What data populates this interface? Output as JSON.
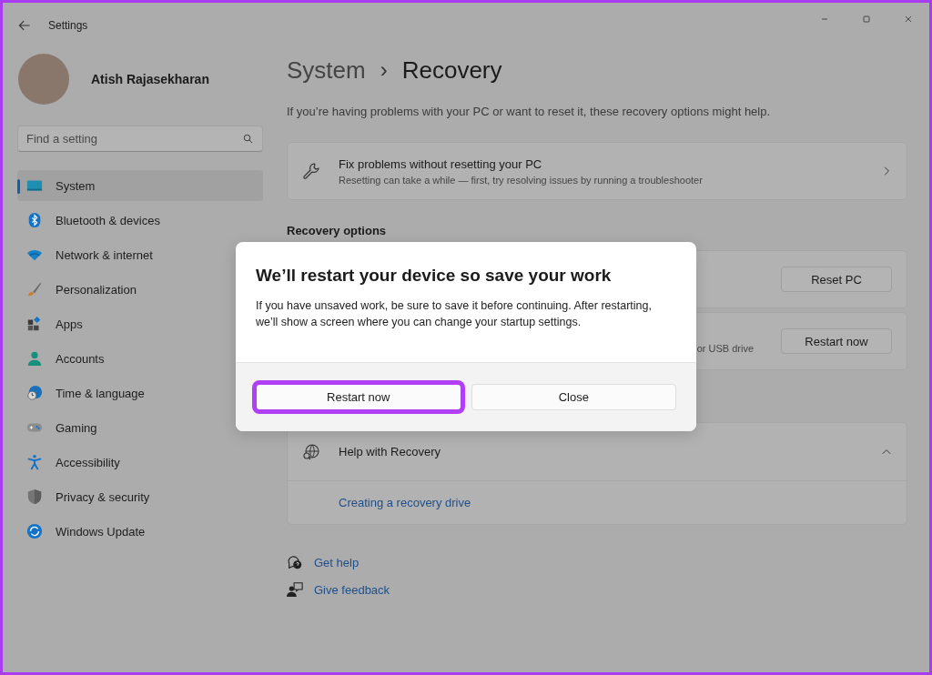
{
  "window": {
    "title": "Settings"
  },
  "profile": {
    "name": "Atish Rajasekharan"
  },
  "search": {
    "placeholder": "Find a setting"
  },
  "sidebar": {
    "items": [
      {
        "label": "System",
        "selected": true
      },
      {
        "label": "Bluetooth & devices",
        "selected": false
      },
      {
        "label": "Network & internet",
        "selected": false
      },
      {
        "label": "Personalization",
        "selected": false
      },
      {
        "label": "Apps",
        "selected": false
      },
      {
        "label": "Accounts",
        "selected": false
      },
      {
        "label": "Time & language",
        "selected": false
      },
      {
        "label": "Gaming",
        "selected": false
      },
      {
        "label": "Accessibility",
        "selected": false
      },
      {
        "label": "Privacy & security",
        "selected": false
      },
      {
        "label": "Windows Update",
        "selected": false
      }
    ]
  },
  "breadcrumb": {
    "parent": "System",
    "separator": "›",
    "current": "Recovery"
  },
  "intro": "If you’re having problems with your PC or want to reset it, these recovery options might help.",
  "fix_card": {
    "title": "Fix problems without resetting your PC",
    "subtitle": "Resetting can take a while — first, try resolving issues by running a troubleshooter"
  },
  "recovery_options": {
    "heading": "Recovery options",
    "rows": [
      {
        "description": "",
        "button": "Reset PC"
      },
      {
        "description": "or USB drive",
        "button": "Restart now"
      }
    ]
  },
  "help_card": {
    "title": "Help with Recovery",
    "expanded": true,
    "links": [
      "Creating a recovery drive"
    ]
  },
  "footer_links": [
    {
      "kind": "help",
      "label": "Get help"
    },
    {
      "kind": "feedback",
      "label": "Give feedback"
    }
  ],
  "dialog": {
    "title": "We’ll restart your device so save your work",
    "body": "If you have unsaved work, be sure to save it before continuing. After restarting, we’ll show a screen where you can change your startup settings.",
    "buttons": [
      {
        "label": "Restart now",
        "highlighted": true
      },
      {
        "label": "Close",
        "highlighted": false
      }
    ]
  }
}
